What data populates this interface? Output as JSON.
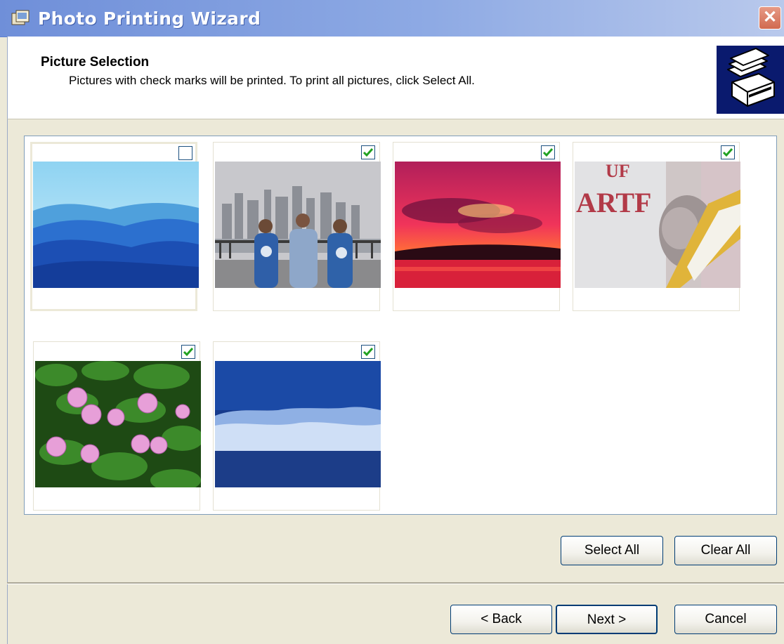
{
  "window": {
    "title": "Photo Printing Wizard",
    "close_glyph": "✕"
  },
  "header": {
    "title": "Picture Selection",
    "subtitle": "Pictures with check marks will be printed.  To print all pictures, click Select All.",
    "icon": "printer-wizard-icon"
  },
  "pictures": [
    {
      "subject": "blue mountains",
      "checked": false
    },
    {
      "subject": "three people by waterfront city",
      "checked": true
    },
    {
      "subject": "red sunset",
      "checked": true
    },
    {
      "subject": "stuffed animal and sweatshirt",
      "checked": true
    },
    {
      "subject": "pink water lilies",
      "checked": true
    },
    {
      "subject": "blue winter trees",
      "checked": true
    }
  ],
  "buttons": {
    "select_all": "Select All",
    "clear_all": "Clear All",
    "back": "< Back",
    "next": "Next >",
    "cancel": "Cancel"
  },
  "colors": {
    "title_bar": "#7b98dd",
    "check": "#21a121",
    "dialog_bg": "#ece9d8"
  }
}
